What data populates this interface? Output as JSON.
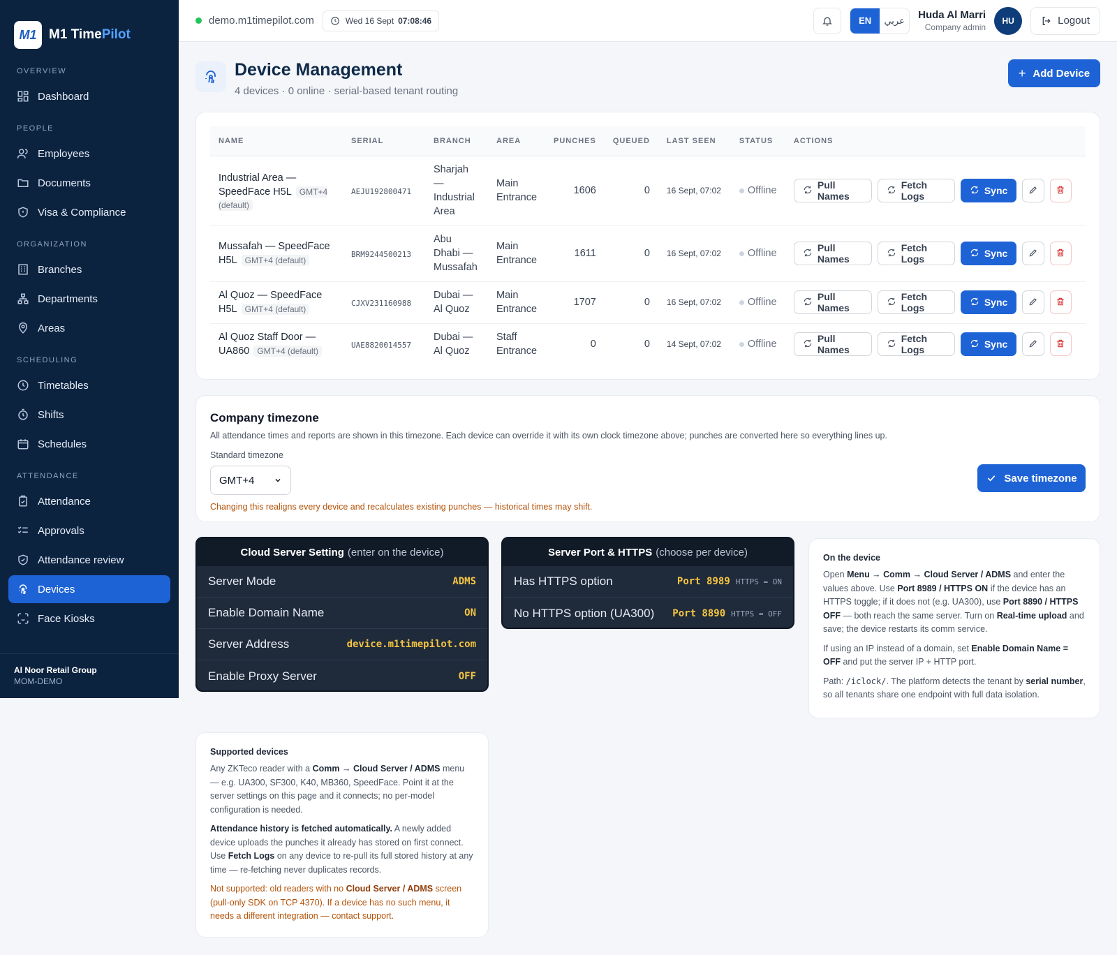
{
  "brand": {
    "logo": "M1",
    "name_main": "M1 Time",
    "name_accent": "Pilot"
  },
  "sidebar": {
    "sections": [
      {
        "label": "OVERVIEW"
      },
      {
        "label": "PEOPLE"
      },
      {
        "label": "ORGANIZATION"
      },
      {
        "label": "SCHEDULING"
      },
      {
        "label": "ATTENDANCE"
      }
    ],
    "items": [
      {
        "label": "Dashboard",
        "icon": "dashboard-icon"
      },
      {
        "label": "Employees",
        "icon": "users-icon"
      },
      {
        "label": "Documents",
        "icon": "folder-icon"
      },
      {
        "label": "Visa & Compliance",
        "icon": "shield-icon"
      },
      {
        "label": "Branches",
        "icon": "building-icon"
      },
      {
        "label": "Departments",
        "icon": "hierarchy-icon"
      },
      {
        "label": "Areas",
        "icon": "map-pin-icon"
      },
      {
        "label": "Timetables",
        "icon": "clock-icon"
      },
      {
        "label": "Shifts",
        "icon": "timer-icon"
      },
      {
        "label": "Schedules",
        "icon": "calendar-icon"
      },
      {
        "label": "Attendance",
        "icon": "clipboard-check-icon"
      },
      {
        "label": "Approvals",
        "icon": "checklist-icon"
      },
      {
        "label": "Attendance review",
        "icon": "shield-check-icon"
      },
      {
        "label": "Devices",
        "icon": "fingerprint-icon",
        "active": true
      },
      {
        "label": "Face Kiosks",
        "icon": "face-scan-icon"
      }
    ],
    "footer": {
      "org": "Al Noor Retail Group",
      "code": "MOM-DEMO"
    }
  },
  "topbar": {
    "domain": "demo.m1timepilot.com",
    "date": "Wed 16 Sept",
    "time": "07:08:46",
    "lang_en": "EN",
    "lang_ar": "عربي",
    "user_name": "Huda Al Marri",
    "user_role": "Company admin",
    "avatar": "HU",
    "logout": "Logout"
  },
  "page": {
    "title": "Device Management",
    "subtitle": "4 devices · 0 online · serial-based tenant routing",
    "add_button": "Add Device"
  },
  "table": {
    "headers": [
      "NAME",
      "SERIAL",
      "BRANCH",
      "AREA",
      "PUNCHES",
      "QUEUED",
      "LAST SEEN",
      "STATUS",
      "ACTIONS"
    ],
    "actions": {
      "pull": "Pull Names",
      "fetch": "Fetch Logs",
      "sync": "Sync"
    },
    "rows": [
      {
        "name": "Industrial Area — SpeedFace H5L",
        "tz": "GMT+4 (default)",
        "serial": "AEJU192800471",
        "branch": "Sharjah — Industrial Area",
        "area": "Main Entrance",
        "punches": "1606",
        "queued": "0",
        "last_seen": "16 Sept, 07:02",
        "status": "Offline"
      },
      {
        "name": "Mussafah — SpeedFace H5L",
        "tz": "GMT+4 (default)",
        "serial": "BRM9244500213",
        "branch": "Abu Dhabi — Mussafah",
        "area": "Main Entrance",
        "punches": "1611",
        "queued": "0",
        "last_seen": "16 Sept, 07:02",
        "status": "Offline"
      },
      {
        "name": "Al Quoz — SpeedFace H5L",
        "tz": "GMT+4 (default)",
        "serial": "CJXV231160988",
        "branch": "Dubai — Al Quoz",
        "area": "Main Entrance",
        "punches": "1707",
        "queued": "0",
        "last_seen": "16 Sept, 07:02",
        "status": "Offline"
      },
      {
        "name": "Al Quoz Staff Door — UA860",
        "tz": "GMT+4 (default)",
        "serial": "UAE8820014557",
        "branch": "Dubai — Al Quoz",
        "area": "Staff Entrance",
        "punches": "0",
        "queued": "0",
        "last_seen": "14 Sept, 07:02",
        "status": "Offline"
      }
    ]
  },
  "timezone": {
    "title": "Company timezone",
    "description": "All attendance times and reports are shown in this timezone. Each device can override it with its own clock timezone above; punches are converted here so everything lines up.",
    "label": "Standard timezone",
    "value": "GMT+4",
    "warning": "Changing this realigns every device and recalculates existing punches — historical times may shift.",
    "save": "Save timezone"
  },
  "cloud_panel": {
    "title": "Cloud Server Setting",
    "title_note": "(enter on the device)",
    "rows": [
      {
        "key": "Server Mode",
        "value": "ADMS"
      },
      {
        "key": "Enable Domain Name",
        "value": "ON"
      },
      {
        "key": "Server Address",
        "value": "device.m1timepilot.com"
      },
      {
        "key": "Enable Proxy Server",
        "value": "OFF"
      }
    ]
  },
  "port_panel": {
    "title": "Server Port & HTTPS",
    "title_note": "(choose per device)",
    "rows": [
      {
        "key": "Has HTTPS option",
        "value": "Port 8989",
        "extra": "HTTPS = ON"
      },
      {
        "key": "No HTTPS option (UA300)",
        "value": "Port 8890",
        "extra": "HTTPS = OFF"
      }
    ]
  },
  "device_info": {
    "title": "On the device",
    "p1": [
      "Open ",
      "Menu → Comm → Cloud Server / ADMS",
      " and enter the values above. Use ",
      "Port 8989 / HTTPS ON",
      " if the device has an HTTPS toggle; if it does not (e.g. UA300), use ",
      "Port 8890 / HTTPS OFF",
      " — both reach the same server. Turn on ",
      "Real-time upload",
      " and save; the device restarts its comm service."
    ],
    "p2": [
      "If using an IP instead of a domain, set ",
      "Enable Domain Name = OFF",
      " and put the server IP + HTTP port."
    ],
    "p3": [
      "Path: ",
      "/iclock/",
      ". The platform detects the tenant by ",
      "serial number",
      ", so all tenants share one endpoint with full data isolation."
    ]
  },
  "supported": {
    "title": "Supported devices",
    "p1": [
      "Any ZKTeco reader with a ",
      "Comm → Cloud Server / ADMS",
      " menu — e.g. UA300, SF300, K40, MB360, SpeedFace. Point it at the server settings on this page and it connects; no per-model configuration is needed."
    ],
    "p2": [
      "Attendance history is fetched automatically.",
      " A newly added device uploads the punches it already has stored on first connect. Use ",
      "Fetch Logs",
      " on any device to re-pull its full stored history at any time — re-fetching never duplicates records."
    ],
    "p3": [
      "Not supported: old readers with no ",
      "Cloud Server / ADMS",
      " screen (pull-only SDK on TCP 4370). If a device has no such menu, it needs a different integration — contact support."
    ]
  }
}
